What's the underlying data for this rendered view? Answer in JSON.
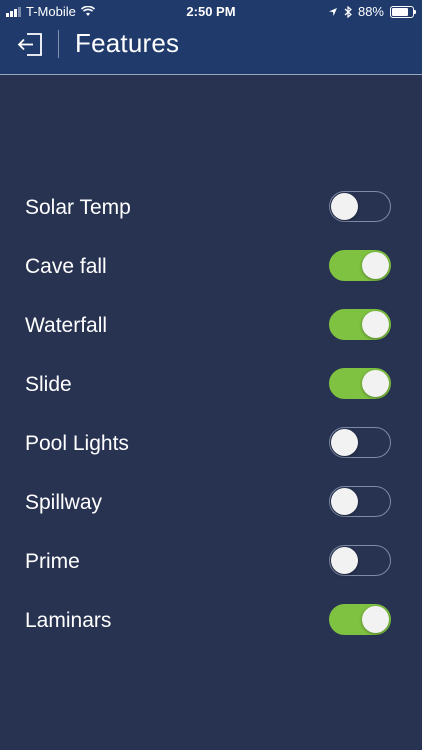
{
  "status_bar": {
    "carrier": "T-Mobile",
    "time": "2:50 PM",
    "battery_percent": "88%",
    "battery_level": 0.88
  },
  "header": {
    "title": "Features",
    "back_icon": "exit-arrow-icon"
  },
  "colors": {
    "background": "#283352",
    "header": "#1f3a6b",
    "toggle_on": "#7fc241"
  },
  "features": [
    {
      "label": "Solar Temp",
      "on": false
    },
    {
      "label": "Cave fall",
      "on": true
    },
    {
      "label": "Waterfall",
      "on": true
    },
    {
      "label": "Slide",
      "on": true
    },
    {
      "label": "Pool Lights",
      "on": false
    },
    {
      "label": "Spillway",
      "on": false
    },
    {
      "label": "Prime",
      "on": false
    },
    {
      "label": "Laminars",
      "on": true
    }
  ]
}
